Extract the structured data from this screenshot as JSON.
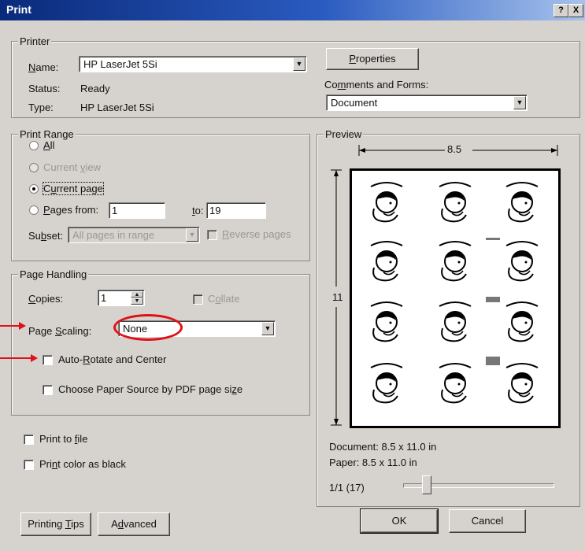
{
  "window": {
    "title": "Print",
    "help_btn": "?",
    "close_btn": "X"
  },
  "printer": {
    "group_label": "Printer",
    "name_label": "Name:",
    "name_value": "HP LaserJet 5Si",
    "status_label": "Status:",
    "status_value": "Ready",
    "type_label": "Type:",
    "type_value": "HP LaserJet 5Si",
    "properties_button": "Properties",
    "comments_label": "Comments and Forms:",
    "comments_value": "Document"
  },
  "print_range": {
    "group_label": "Print Range",
    "all": "All",
    "current_view": "Current view",
    "current_page": "Current page",
    "pages_from": "Pages from:",
    "from_value": "1",
    "to_label": "to:",
    "to_value": "19",
    "subset_label": "Subset:",
    "subset_value": "All pages in range",
    "reverse_pages": "Reverse pages",
    "selected": "current_page"
  },
  "page_handling": {
    "group_label": "Page Handling",
    "copies_label": "Copies:",
    "copies_value": "1",
    "collate": "Collate",
    "page_scaling_label": "Page Scaling:",
    "page_scaling_value": "None",
    "auto_rotate": "Auto-Rotate and Center",
    "choose_paper": "Choose Paper Source by PDF page size"
  },
  "options": {
    "print_to_file": "Print to file",
    "print_color_black": "Print color as black"
  },
  "preview": {
    "group_label": "Preview",
    "width_dim": "8.5",
    "height_dim": "11",
    "document_size": "Document: 8.5 x 11.0 in",
    "paper_size": "Paper: 8.5 x 11.0 in",
    "page_indicator": "1/1 (17)"
  },
  "buttons": {
    "printing_tips": "Printing Tips",
    "advanced": "Advanced",
    "ok": "OK",
    "cancel": "Cancel"
  },
  "colors": {
    "annotation_red": "#e0101a",
    "title_blue": "#0a2a7a",
    "dialog_bg": "#d6d3ce"
  }
}
